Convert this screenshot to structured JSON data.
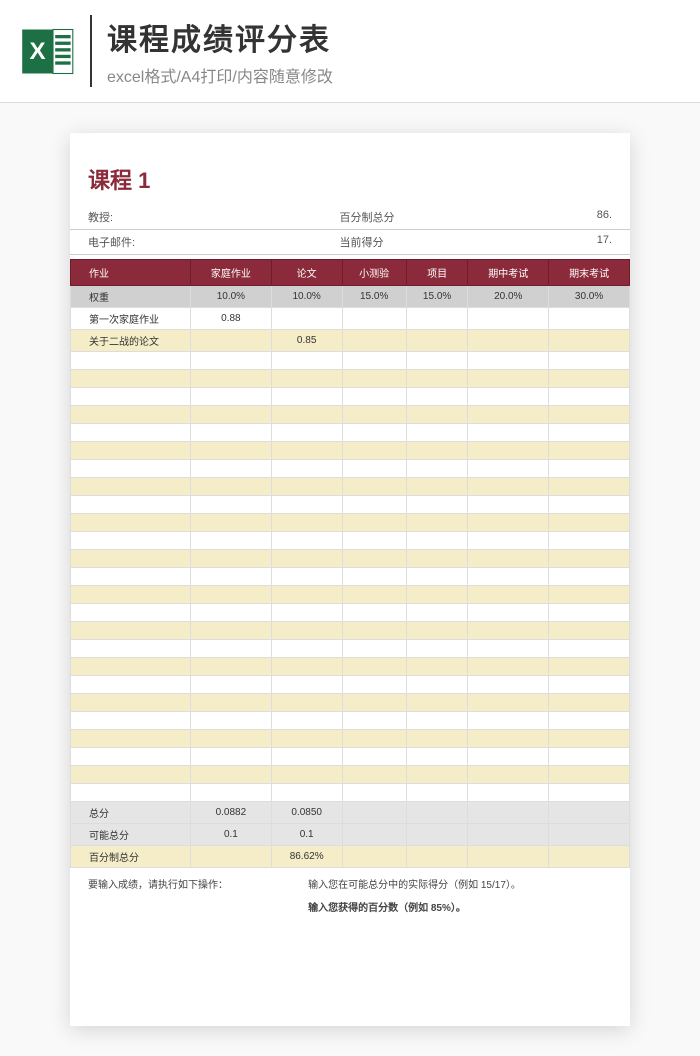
{
  "header": {
    "title": "课程成绩评分表",
    "subtitle": "excel格式/A4打印/内容随意修改",
    "icon_label": "X",
    "icon_sub": "≡"
  },
  "sheet": {
    "course_title": "课程 1",
    "info": {
      "professor_label": "教授:",
      "email_label": "电子邮件:",
      "total_score_label": "百分制总分",
      "total_score_value": "86.",
      "current_score_label": "当前得分",
      "current_score_value": "17."
    },
    "columns": [
      "作业",
      "家庭作业",
      "论文",
      "小测验",
      "项目",
      "期中考试",
      "期末考试"
    ],
    "weight_label": "权重",
    "weights": [
      "10.0%",
      "10.0%",
      "15.0%",
      "15.0%",
      "20.0%",
      "30.0%"
    ],
    "rows": [
      {
        "label": "第一次家庭作业",
        "values": [
          "0.88",
          "",
          "",
          "",
          "",
          ""
        ]
      },
      {
        "label": "关于二战的论文",
        "values": [
          "",
          "0.85",
          "",
          "",
          "",
          ""
        ]
      }
    ],
    "empty_rows": 25,
    "summary": {
      "total_label": "总分",
      "total_values": [
        "0.0882",
        "0.0850",
        "",
        "",
        "",
        ""
      ],
      "possible_label": "可能总分",
      "possible_values": [
        "0.1",
        "0.1",
        "",
        "",
        "",
        ""
      ],
      "percent_label": "百分制总分",
      "percent_values": [
        "",
        "86.62%",
        "",
        "",
        "",
        ""
      ]
    },
    "instructions": {
      "intro": "要输入成绩，请执行如下操作：",
      "line1": "输入您在可能总分中的实际得分（例如 15/17）。",
      "line2": "输入您获得的百分数（例如 85%）。"
    }
  }
}
